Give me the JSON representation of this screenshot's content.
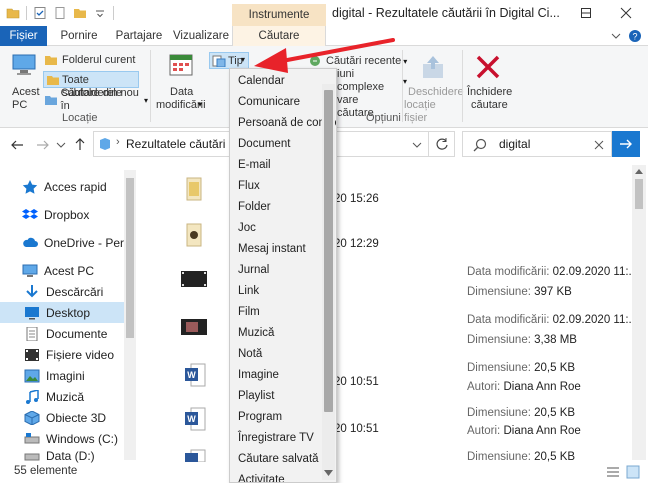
{
  "window": {
    "title": "digital - Rezultatele căutării în Digital Ci...",
    "context_tab_header": "Instrumente căutare",
    "controls": {
      "minimize": "─",
      "maximize": "☐",
      "close": "✕"
    }
  },
  "tabs": {
    "file": "Fișier",
    "home": "Pornire",
    "share": "Partajare",
    "view": "Vizualizare",
    "search": "Căutare"
  },
  "ribbon": {
    "this_pc": "Acest PC",
    "current_folder": "Folderul curent",
    "all_subfolders": "Toate subfolderele",
    "search_again": "Căutare din nou în",
    "location_group": "Locație",
    "date_modified": [
      "Data",
      "modificării"
    ],
    "type_button": "Tip",
    "recent_searches": "Căutări recente",
    "advanced_options": "iuni complexe",
    "save_search": "vare căutare",
    "options_group": "Opțiuni",
    "open_location": [
      "Deschidere",
      "locație fișier"
    ],
    "close_search": [
      "Închidere",
      "căutare"
    ]
  },
  "nav": {
    "address": "Rezultatele căutări",
    "search_value": "digital"
  },
  "sidebar": {
    "items": [
      {
        "label": "Acces rapid",
        "icon": "star-icon"
      },
      {
        "label": "Dropbox",
        "icon": "dropbox-icon"
      },
      {
        "label": "OneDrive - Person",
        "icon": "cloud-icon"
      },
      {
        "label": "Acest PC",
        "icon": "computer-icon"
      },
      {
        "label": "Descărcări",
        "icon": "download-icon"
      },
      {
        "label": "Desktop",
        "icon": "desktop-icon"
      },
      {
        "label": "Documente",
        "icon": "documents-icon"
      },
      {
        "label": "Fișiere video",
        "icon": "video-icon"
      },
      {
        "label": "Imagini",
        "icon": "pictures-icon"
      },
      {
        "label": "Muzică",
        "icon": "music-icon"
      },
      {
        "label": "Obiecte 3D",
        "icon": "3d-objects-icon"
      },
      {
        "label": "Windows (C:)",
        "icon": "drive-icon"
      },
      {
        "label": "Data (D:)",
        "icon": "drive-icon"
      }
    ]
  },
  "files": [
    {
      "datetime": "20 15:26"
    },
    {
      "datetime": "20 12:29"
    },
    {
      "meta1_label": "Data modificării:",
      "meta1_value": "02.09.2020 11:...",
      "meta2_label": "Dimensiune:",
      "meta2_value": "397 KB"
    },
    {
      "meta1_label": "Data modificării:",
      "meta1_value": "02.09.2020 11:...",
      "meta2_label": "Dimensiune:",
      "meta2_value": "3,38 MB"
    },
    {
      "datetime": "20 10:51",
      "meta1_label": "Dimensiune:",
      "meta1_value": "20,5 KB",
      "meta2_label": "Autori:",
      "meta2_value": "Diana Ann Roe"
    },
    {
      "datetime": "20 10:51",
      "meta1_label": "Dimensiune:",
      "meta1_value": "20,5 KB",
      "meta2_label": "Autori:",
      "meta2_value": "Diana Ann Roe"
    },
    {
      "meta1_label": "Dimensiune:",
      "meta1_value": "20,5 KB"
    }
  ],
  "dropdown": {
    "items": [
      "Calendar",
      "Comunicare",
      "Persoană de contact",
      "Document",
      "E-mail",
      "Flux",
      "Folder",
      "Joc",
      "Mesaj instant",
      "Jurnal",
      "Link",
      "Film",
      "Muzică",
      "Notă",
      "Imagine",
      "Playlist",
      "Program",
      "Înregistrare TV",
      "Căutare salvată",
      "Activitate"
    ]
  },
  "status": {
    "count": "55 elemente"
  },
  "colors": {
    "accent": "#1a64b8",
    "context_tab": "#f7e3c4",
    "arrow": "#e8232a"
  }
}
